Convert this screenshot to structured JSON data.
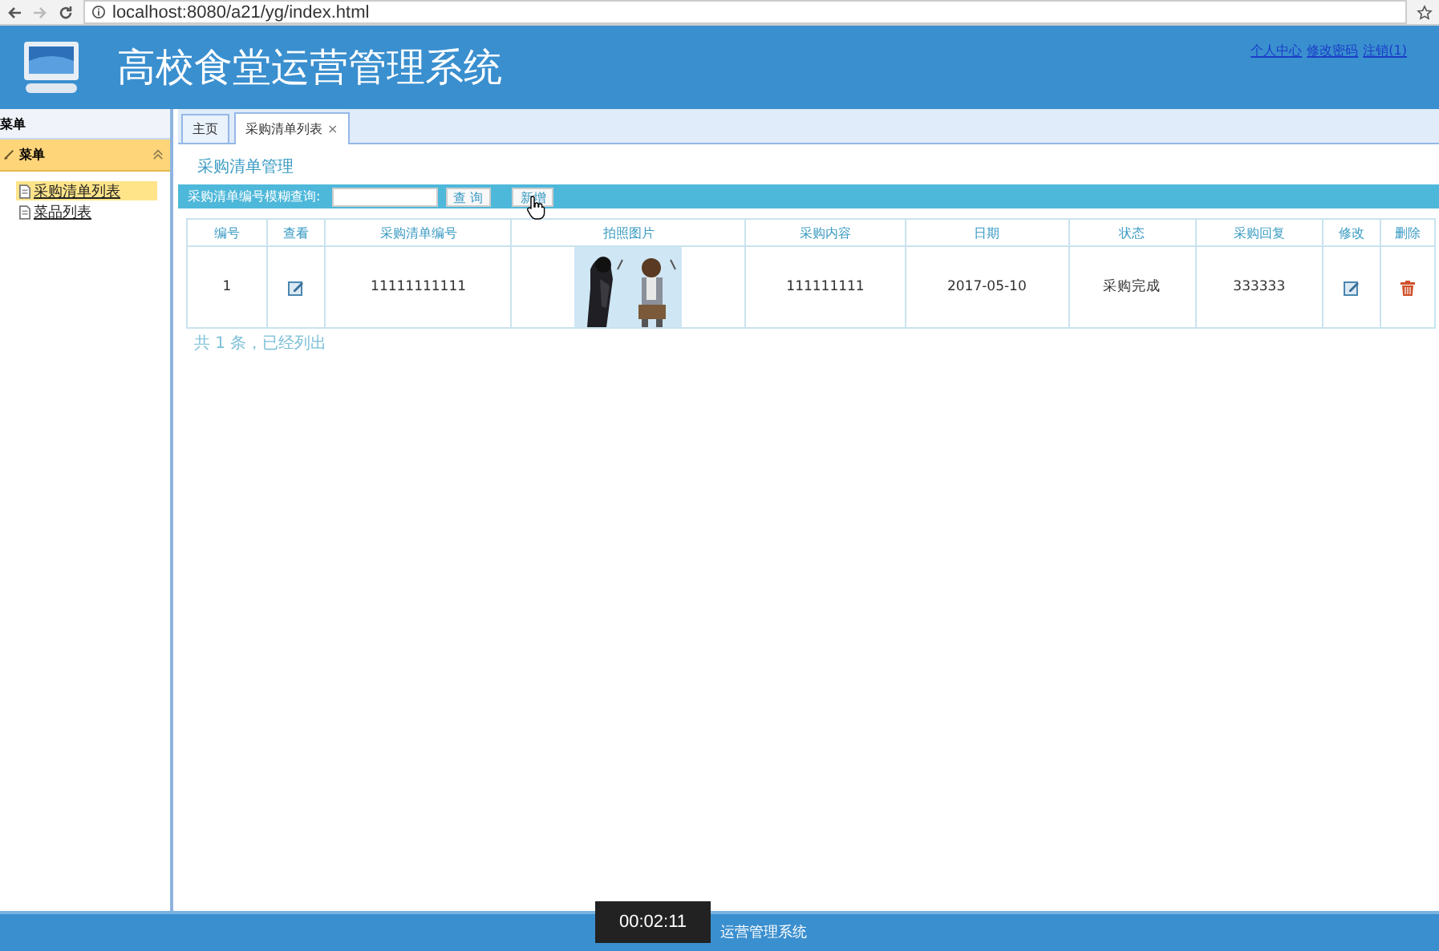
{
  "browser": {
    "url": "localhost:8080/a21/yg/index.html"
  },
  "header": {
    "title": "高校食堂运营管理系统",
    "links": [
      "个人中心",
      "修改密码",
      "注销(1)"
    ]
  },
  "sidebar": {
    "title": "菜单",
    "section": {
      "label": "菜单",
      "expanded": true,
      "items": [
        {
          "label": "采购清单列表",
          "selected": true
        },
        {
          "label": "菜品列表",
          "selected": false
        }
      ]
    }
  },
  "tabs": [
    {
      "label": "主页",
      "selected": false
    },
    {
      "label": "采购清单列表",
      "selected": true,
      "close": "×"
    }
  ],
  "page_title": "采购清单管理",
  "search": {
    "label": "采购清单编号模糊查询:",
    "buttons": [
      {
        "label": "查 询",
        "hovered": false
      },
      {
        "label": "新增",
        "hovered": true
      }
    ]
  },
  "table": {
    "columns": [
      "编号",
      "查看",
      "采购清单编号",
      "拍照图片",
      "采购内容",
      "日期",
      "状态",
      "采购回复",
      "修改",
      "删除"
    ],
    "rows": [
      {
        "cells": [
          {
            "kind": "text",
            "text": "1"
          },
          {
            "kind": "view"
          },
          {
            "kind": "text",
            "text": "11111111111"
          },
          {
            "kind": "picture"
          },
          {
            "kind": "text",
            "text": "111111111"
          },
          {
            "kind": "text",
            "text": "2017-05-10"
          },
          {
            "kind": "text",
            "text": "采购完成"
          },
          {
            "kind": "text",
            "text": "333333"
          },
          {
            "kind": "edit"
          },
          {
            "kind": "delete"
          }
        ]
      }
    ]
  },
  "summary": "共 1 条，已经列出",
  "footer": "运营管理系统",
  "video_time": "00:02:11"
}
